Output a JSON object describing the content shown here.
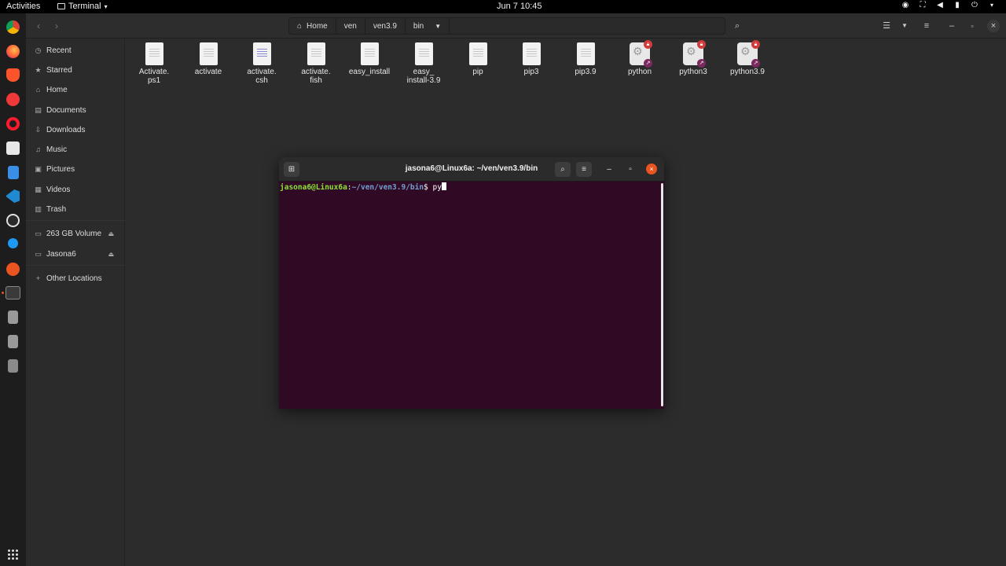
{
  "topbar": {
    "activities": "Activities",
    "app_name": "Terminal",
    "clock": "Jun 7  10:45"
  },
  "dock": {
    "apps": [
      "chrome-icon",
      "firefox-icon",
      "brave-icon",
      "vivaldi-icon",
      "opera-icon",
      "files-icon",
      "docs-icon",
      "vscode-icon",
      "obs-icon",
      "kdenlive-icon",
      "ubuntu-software-icon",
      "terminal-icon",
      "usb-drive-icon",
      "usb-drive-icon-2",
      "disk-icon"
    ]
  },
  "file_manager": {
    "breadcrumbs": [
      "Home",
      "ven",
      "ven3.9",
      "bin"
    ],
    "sidebar": [
      {
        "label": "Recent",
        "icon": "clock-icon"
      },
      {
        "label": "Starred",
        "icon": "star-icon"
      },
      {
        "label": "Home",
        "icon": "home-icon"
      },
      {
        "label": "Documents",
        "icon": "document-icon"
      },
      {
        "label": "Downloads",
        "icon": "download-icon"
      },
      {
        "label": "Music",
        "icon": "music-icon"
      },
      {
        "label": "Pictures",
        "icon": "picture-icon"
      },
      {
        "label": "Videos",
        "icon": "video-icon"
      },
      {
        "label": "Trash",
        "icon": "trash-icon"
      },
      {
        "label": "263 GB Volume",
        "icon": "drive-icon"
      },
      {
        "label": "Jasona6",
        "icon": "drive-icon"
      },
      {
        "label": "Other Locations",
        "icon": "plus-icon"
      }
    ],
    "files": [
      {
        "line1": "Activate.",
        "line2": "ps1",
        "kind": "text"
      },
      {
        "line1": "activate",
        "line2": "",
        "kind": "text"
      },
      {
        "line1": "activate.",
        "line2": "csh",
        "kind": "code"
      },
      {
        "line1": "activate.",
        "line2": "fish",
        "kind": "text"
      },
      {
        "line1": "easy_install",
        "line2": "",
        "kind": "text"
      },
      {
        "line1": "easy_",
        "line2": "install-3.9",
        "kind": "text"
      },
      {
        "line1": "pip",
        "line2": "",
        "kind": "text"
      },
      {
        "line1": "pip3",
        "line2": "",
        "kind": "text"
      },
      {
        "line1": "pip3.9",
        "line2": "",
        "kind": "text"
      },
      {
        "line1": "python",
        "line2": "",
        "kind": "exec"
      },
      {
        "line1": "python3",
        "line2": "",
        "kind": "exec"
      },
      {
        "line1": "python3.9",
        "line2": "",
        "kind": "exec"
      }
    ]
  },
  "terminal": {
    "title": "jasona6@Linux6a: ~/ven/ven3.9/bin",
    "prompt_user": "jasona6@Linux6a",
    "prompt_sep": ":",
    "prompt_path": "~/ven/ven3.9/bin",
    "prompt_dollar": "$ ",
    "command": "py"
  }
}
